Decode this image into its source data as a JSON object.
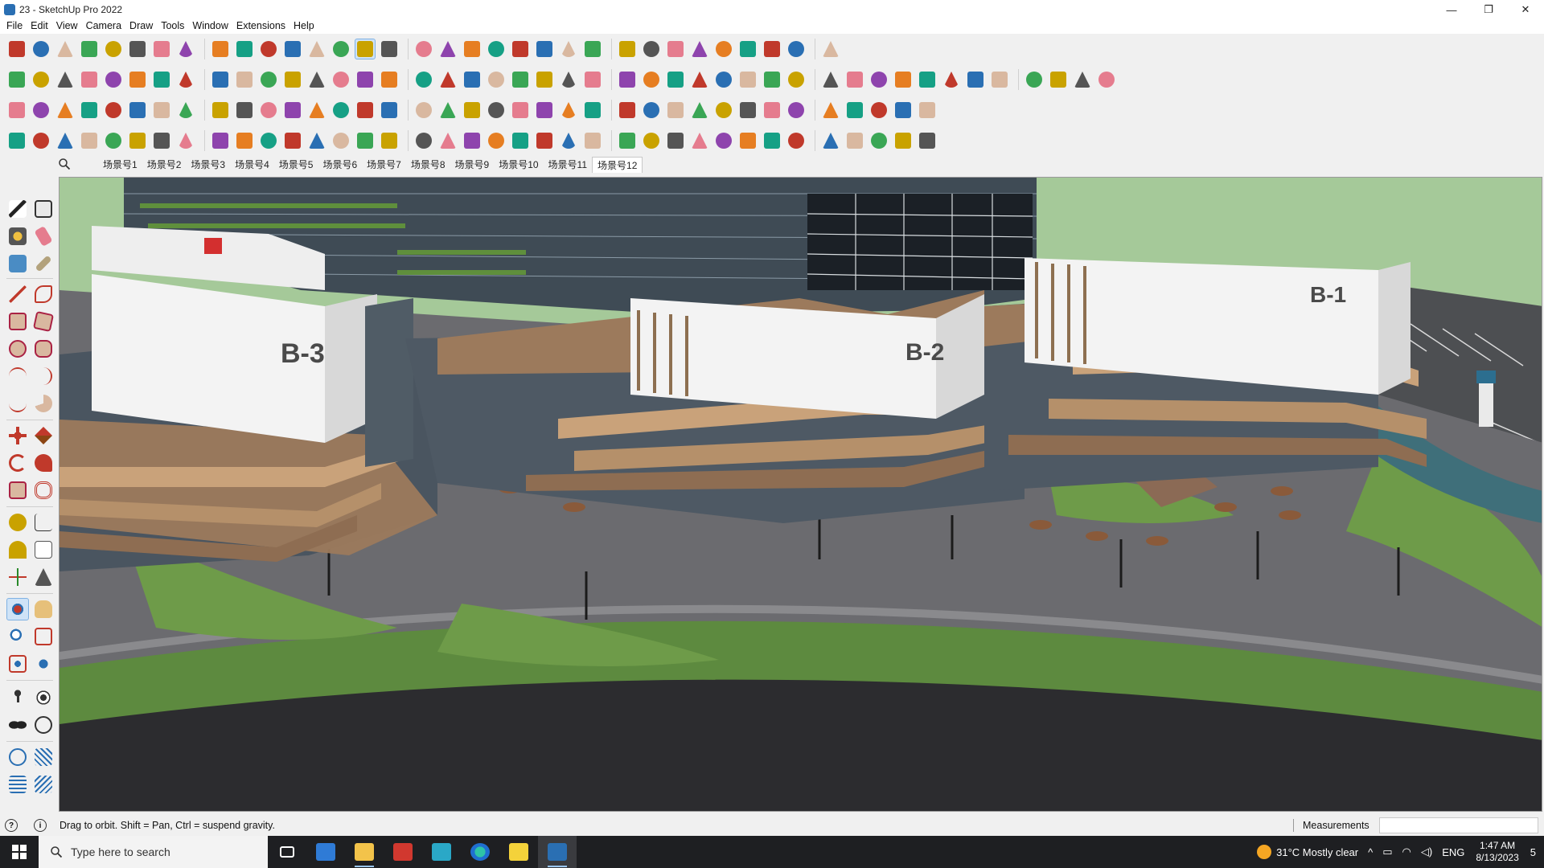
{
  "window": {
    "title": "23 - SketchUp Pro 2022",
    "controls": [
      "—",
      "❐",
      "✕"
    ]
  },
  "menu": [
    "File",
    "Edit",
    "View",
    "Camera",
    "Draw",
    "Tools",
    "Window",
    "Extensions",
    "Help"
  ],
  "toolbars": {
    "row1": [
      "zoom-extents-icon",
      "select-icon",
      "eraser-icon",
      "line-icon",
      "arc-icon",
      "shape-icon",
      "push-pull-icon",
      "follow-me-icon",
      "move-icon",
      "rotate-icon",
      "scale-icon",
      "tape-icon",
      "text-icon",
      "paint-icon",
      "orbit-icon",
      "pan-icon",
      "zoom-icon",
      "zoom-window-icon",
      "layers-icon",
      "sandbox-icon",
      "stack-icon",
      "component-icon",
      "user-icon",
      "warehouse-icon",
      "extension-warehouse-icon",
      "layout-icon",
      "flip-icon",
      "align-icon",
      "wall-icon",
      "fix-icon",
      "undo-icon",
      "redo-icon",
      "render-icon"
    ],
    "row2": [
      "box-icon",
      "cube-icon",
      "sphere-icon",
      "extrude-icon",
      "lift-icon",
      "push-icon",
      "drop-icon",
      "green-arrow-icon",
      "north-icon",
      "x-icon",
      "f-icon",
      "lasso-icon",
      "slash-icon",
      "slash-icon",
      "slash-icon",
      "shape-icon",
      "tool-icon",
      "house-icon",
      "house-icon",
      "house-icon",
      "house-icon",
      "house-icon",
      "fn-icon",
      "hand-icon",
      "pencil-icon",
      "ring-icon",
      "ring-icon",
      "ring-icon",
      "ring-icon",
      "ring-icon",
      "ring-icon",
      "ring-icon",
      "ring-icon",
      "ring-icon",
      "ring-icon",
      "arrow-icon",
      "eraser-icon",
      "tile-icon",
      "tile-icon",
      "tile-icon",
      "tile-icon",
      "tile-icon",
      "tile-icon",
      "tile-icon"
    ],
    "row3": [
      "layer-icon",
      "layer-icon",
      "layer-icon",
      "layer-icon",
      "layer-icon",
      "layer-icon",
      "curl-icon",
      "square-icon",
      "list-icon",
      "door-icon",
      "fixture-icon",
      "link-icon",
      "curve-icon",
      "dots-icon",
      "plus-icon",
      "cross-icon",
      "cone-icon",
      "warning-icon",
      "circle-icon",
      "circle-icon",
      "circle-icon",
      "star-icon",
      "box-icon",
      "undo-icon",
      "tree-icon",
      "copy-icon",
      "copy-icon",
      "copy-icon",
      "tag-icon",
      "gear-icon",
      "frame-icon",
      "grid-icon",
      "grid-icon",
      "grid-icon",
      "cross-icon",
      "curve-icon",
      "grid-icon"
    ],
    "row4": [
      "path-icon",
      "path-icon",
      "cut-icon",
      "gear-icon",
      "gear-icon",
      "rope-icon",
      "sketch-icon",
      "sketch-icon",
      "sketch-icon",
      "corner-icon",
      "corner-icon",
      "line-icon",
      "line-icon",
      "arch-icon",
      "shell-icon",
      "grip-icon",
      "hand-icon",
      "bowl-icon",
      "leaf-icon",
      "stair-icon",
      "pen-icon",
      "wing-icon",
      "wing-icon",
      "wing-icon",
      "rail-icon",
      "rail-icon",
      "rail-icon",
      "rail-icon",
      "frame-icon",
      "hatch-icon",
      "stripe-icon",
      "stripe-icon",
      "stripe-icon",
      "stripe-icon",
      "stripe-icon",
      "stripe-icon",
      "home-icon"
    ]
  },
  "scenes": {
    "tabs": [
      "场景号1",
      "场景号2",
      "场景号3",
      "场景号4",
      "场景号5",
      "场景号6",
      "场景号7",
      "场景号8",
      "场景号9",
      "场景号10",
      "场景号11",
      "场景号12"
    ],
    "active_index": 11
  },
  "viewport": {
    "building_labels": [
      "B-3",
      "B-2",
      "B-1"
    ],
    "colors": {
      "sky": "#9fc48e",
      "ground": "#3b3b3f",
      "lawn": "#6c9a4a",
      "deck": "#9c7a5c",
      "wall": "#f4f4f4",
      "glass": "#5b6e78",
      "tower": "#3a4650"
    }
  },
  "status": {
    "hint": "Drag to orbit. Shift = Pan, Ctrl = suspend gravity.",
    "measurements_label": "Measurements",
    "measurements_value": ""
  },
  "taskbar": {
    "search_placeholder": "Type here to search",
    "weather": "31°C  Mostly clear",
    "language": "ENG",
    "time": "1:47 AM",
    "date": "8/13/2023",
    "notification_count": "5"
  }
}
